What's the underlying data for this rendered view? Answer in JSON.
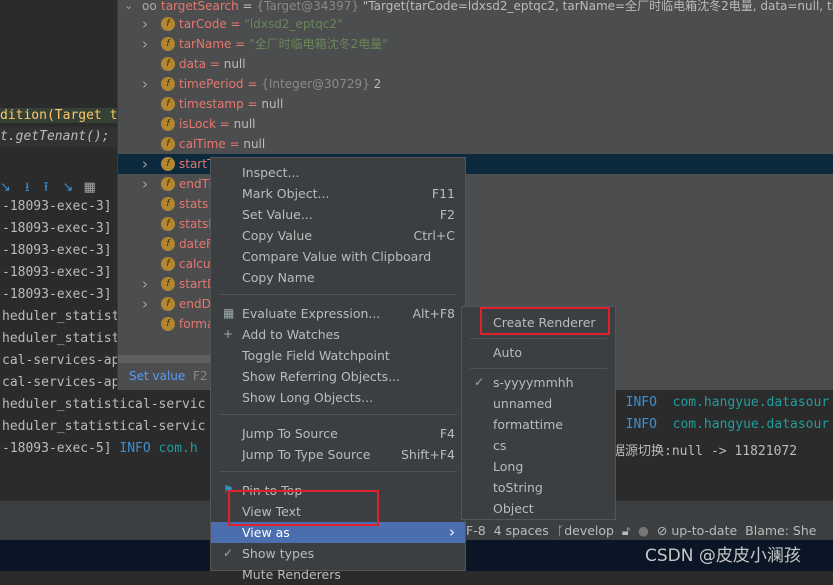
{
  "editor": {
    "lines": [
      "dition(Target t",
      "t.getTenant();"
    ]
  },
  "variables": {
    "root": {
      "name": "targetSearch",
      "eq": " = ",
      "type": "{Target@34397}",
      "value": " \"Target(tarCode=ldxsd2_eptqc2, tarName=全厂时临电箱沈冬2电量, data=null, timePe"
    },
    "rows": [
      {
        "name": "tarCode",
        "value": "\"ldxsd2_eptqc2\"",
        "kind": "str",
        "expand": true
      },
      {
        "name": "tarName",
        "value": "\"全厂时临电箱沈冬2电量\"",
        "kind": "str",
        "expand": true
      },
      {
        "name": "data",
        "value": "null",
        "kind": "val",
        "expand": false
      },
      {
        "name": "timePeriod",
        "type": "{Integer@30729}",
        "value": "2",
        "kind": "val",
        "expand": true
      },
      {
        "name": "timestamp",
        "value": "null",
        "kind": "val",
        "expand": false
      },
      {
        "name": "isLock",
        "value": "null",
        "kind": "val",
        "expand": false
      },
      {
        "name": "calTime",
        "value": "null",
        "kind": "val",
        "expand": false
      },
      {
        "name": "startT",
        "value": "",
        "kind": "val",
        "expand": true,
        "selected": true
      },
      {
        "name": "endTi",
        "value": "",
        "kind": "val",
        "expand": true
      },
      {
        "name": "stats",
        "value": "",
        "kind": "val",
        "expand": false
      },
      {
        "name": "statsF",
        "value": "",
        "kind": "val",
        "expand": false
      },
      {
        "name": "dateF",
        "value": "",
        "kind": "val",
        "expand": false
      },
      {
        "name": "calcul",
        "value": "",
        "kind": "val",
        "expand": false
      },
      {
        "name": "startD",
        "value": "",
        "kind": "val",
        "expand": true
      },
      {
        "name": "endD",
        "value": "",
        "kind": "val",
        "expand": true
      },
      {
        "name": "forma",
        "value": "",
        "kind": "val",
        "expand": false
      }
    ],
    "hint_label": "Set value",
    "hint_shortcut": "F2"
  },
  "console": {
    "left_lines": [
      "-18093-exec-3]",
      "-18093-exec-3]",
      "-18093-exec-3]",
      "-18093-exec-3]",
      "-18093-exec-3]",
      "heduler_statist",
      "heduler_statist",
      "cal-services-ap",
      "cal-services-ap",
      "heduler_statistical-servic",
      "heduler_statistical-servic",
      "-18093-exec-5]"
    ],
    "last_level": "INFO",
    "last_logger": "com.h",
    "right_lines": [
      {
        "level": "INFO",
        "logger": "com.hangyue.datasour"
      },
      {
        "level": "INFO",
        "logger": "com.hangyue.datasour"
      }
    ],
    "right_text": "据源切换:null -> 11821072"
  },
  "context_menu": {
    "groups": [
      [
        {
          "label": "Inspect..."
        },
        {
          "label": "Mark Object...",
          "shortcut": "F11"
        },
        {
          "label": "Set Value...",
          "shortcut": "F2"
        },
        {
          "label": "Copy Value",
          "shortcut": "Ctrl+C"
        },
        {
          "label": "Compare Value with Clipboard"
        },
        {
          "label": "Copy Name"
        }
      ],
      [
        {
          "label": "Evaluate Expression...",
          "shortcut": "Alt+F8",
          "icon": "calculator-icon"
        },
        {
          "label": "Add to Watches",
          "icon": "add-watch-icon"
        },
        {
          "label": "Toggle Field Watchpoint"
        },
        {
          "label": "Show Referring Objects..."
        },
        {
          "label": "Show Long Objects..."
        }
      ],
      [
        {
          "label": "Jump To Source",
          "shortcut": "F4"
        },
        {
          "label": "Jump To Type Source",
          "shortcut": "Shift+F4"
        }
      ],
      [
        {
          "label": "Pin to Top",
          "icon": "pin-flag-icon"
        },
        {
          "label": "View Text"
        },
        {
          "label": "View as",
          "submenu": true,
          "highlighted": true
        },
        {
          "label": "Show types",
          "checked": true
        },
        {
          "label": "Mute Renderers"
        }
      ]
    ]
  },
  "submenu": {
    "create": "Create Renderer",
    "auto": "Auto",
    "renderers": [
      {
        "label": "s-yyyymmhh",
        "checked": true
      },
      {
        "label": "unnamed"
      },
      {
        "label": "formattime"
      },
      {
        "label": "cs"
      },
      {
        "label": "Long"
      },
      {
        "label": "toString"
      },
      {
        "label": "Object"
      }
    ]
  },
  "statusbar": {
    "encoding": "F-8",
    "indent": "4 spaces",
    "branch": "develop",
    "vcs": "up-to-date",
    "blame": "Blame: She"
  },
  "watermark": "CSDN @皮皮小澜孩",
  "colors": {
    "selection": "#0d293e",
    "highlight": "#4b6eaf",
    "annotation": "#e0202a",
    "field_icon": "#b3862f"
  }
}
